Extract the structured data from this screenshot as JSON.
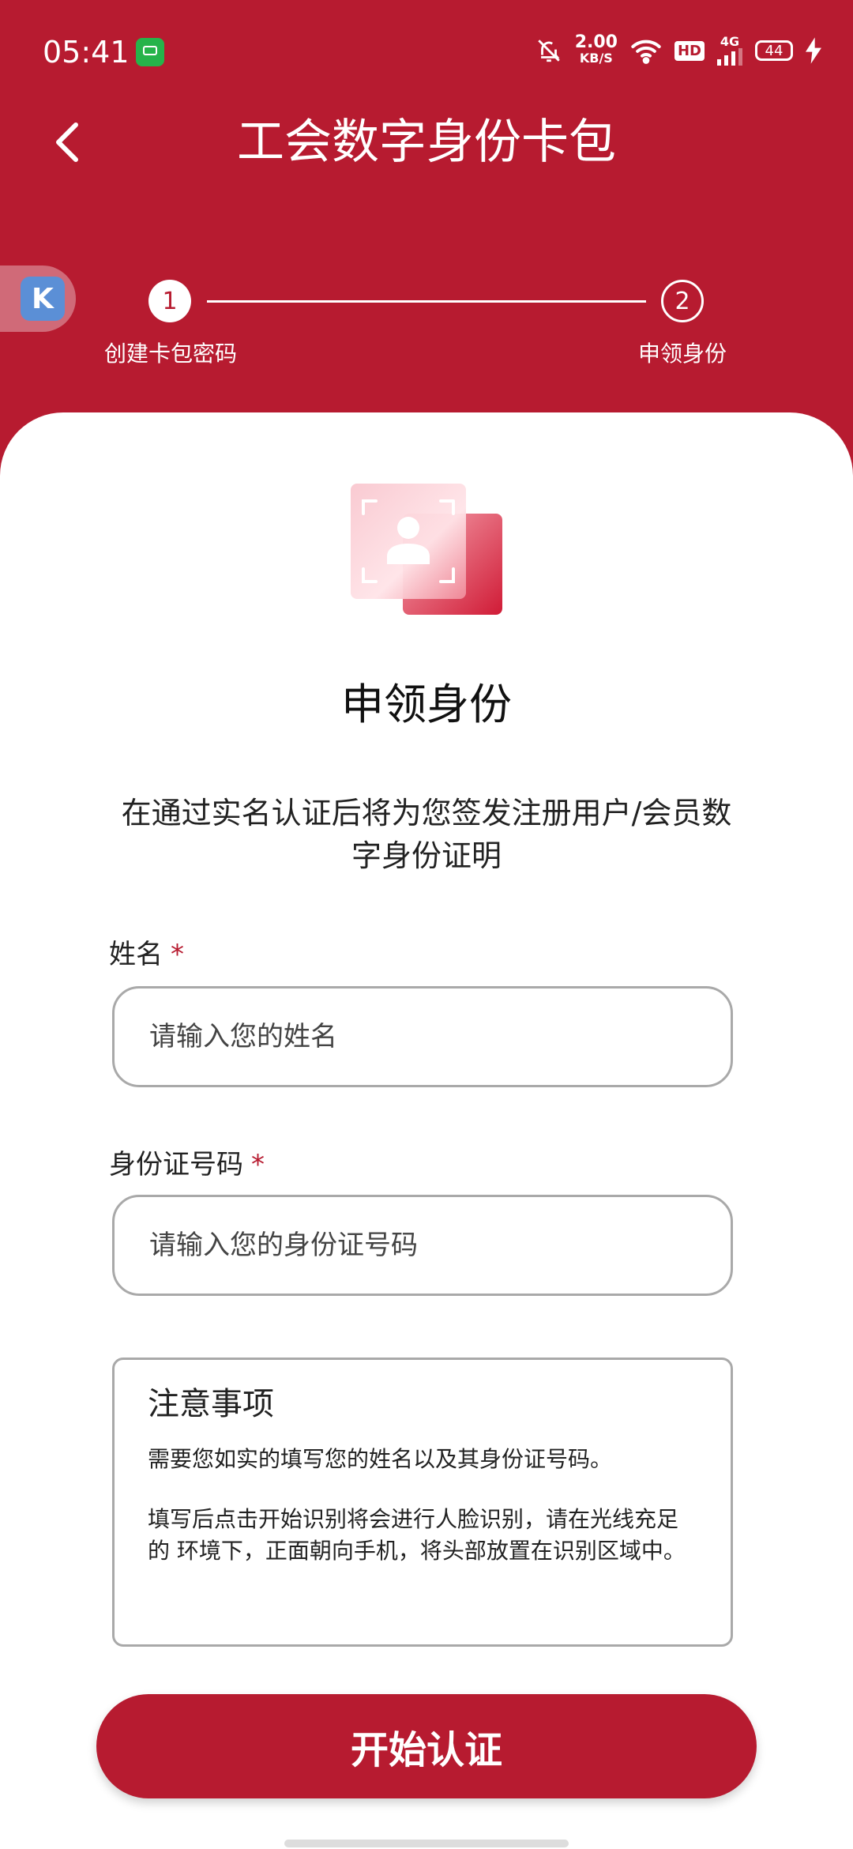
{
  "status_bar": {
    "time": "05:41",
    "net_speed_value": "2.00",
    "net_speed_unit": "KB/S",
    "hd_label": "HD",
    "network_label": "4G",
    "battery_level": "44",
    "icons": [
      "message-app-icon",
      "mute-bell-icon",
      "wifi-icon",
      "signal-icon",
      "charging-icon"
    ]
  },
  "header": {
    "title": "工会数字身份卡包",
    "back_icon": "chevron-left-icon"
  },
  "floating_button": {
    "label": "K"
  },
  "stepper": {
    "steps": [
      {
        "number": "1",
        "label": "创建卡包密码",
        "state": "done"
      },
      {
        "number": "2",
        "label": "申领身份",
        "state": "current"
      }
    ]
  },
  "main": {
    "illustration": "id-card-icon",
    "title": "申领身份",
    "description": "在通过实名认证后将为您签发注册用户/会员数字身份证明"
  },
  "form": {
    "name": {
      "label": "姓名",
      "required_mark": "*",
      "placeholder": "请输入您的姓名",
      "value": ""
    },
    "id_number": {
      "label": "身份证号码",
      "required_mark": "*",
      "placeholder": "请输入您的身份证号码",
      "value": ""
    }
  },
  "notice": {
    "title": "注意事项",
    "paragraphs": [
      "需要您如实的填写您的姓名以及其身份证号码。",
      "填写后点击开始识别将会进行人脸识别，请在光线充足的 环境下，正面朝向手机，将头部放置在识别区域中。"
    ]
  },
  "actions": {
    "start_label": "开始认证"
  },
  "colors": {
    "primary": "#B71B30",
    "background": "#FFFFFF",
    "border": "#A9A9A9"
  }
}
